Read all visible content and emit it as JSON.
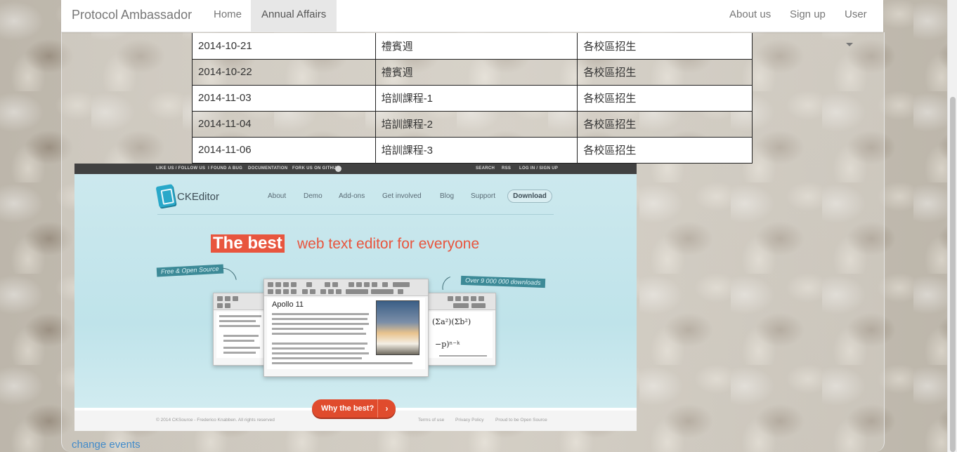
{
  "navbar": {
    "brand": "Protocol Ambassador",
    "items": [
      {
        "label": "Home",
        "active": false
      },
      {
        "label": "Annual Affairs",
        "active": true
      }
    ],
    "right_items": [
      {
        "label": "About us"
      },
      {
        "label": "Sign up"
      },
      {
        "label": "User"
      }
    ]
  },
  "events": [
    {
      "date": "2014-10-21",
      "name": "禮賓週",
      "note": "各校區招生"
    },
    {
      "date": "2014-10-22",
      "name": "禮賓週",
      "note": "各校區招生"
    },
    {
      "date": "2014-11-03",
      "name": "培訓課程-1",
      "note": "各校區招生"
    },
    {
      "date": "2014-11-04",
      "name": "培訓課程-2",
      "note": "各校區招生"
    },
    {
      "date": "2014-11-06",
      "name": "培訓課程-3",
      "note": "各校區招生"
    }
  ],
  "banner": {
    "topbar": {
      "left": [
        "LIKE US / FOLLOW US",
        "I FOUND A BUG",
        "DOCUMENTATION",
        "FORK US ON GITHUB"
      ],
      "right": [
        "SEARCH",
        "RSS",
        "LOG IN / SIGN UP"
      ]
    },
    "logo": "CKEditor",
    "nav": [
      "About",
      "Demo",
      "Add-ons",
      "Get involved",
      "Blog",
      "Support"
    ],
    "download": "Download",
    "headline_highlight": "The best",
    "headline_rest": "web text editor for everyone",
    "tag_left": "Free & Open Source",
    "tag_right": "Over 9 000 000 downloads",
    "editor_title": "Apollo 11",
    "cta": "Why the best?",
    "cta_arrow": "›",
    "footer_copy": "© 2014 CKSource - Frederico Knabben. All rights reserved",
    "footer_links": [
      "Terms of use",
      "Privacy Policy",
      "Proud to be Open Source"
    ]
  },
  "change_link": "change events",
  "colors": {
    "accent": "#e8553e",
    "link": "#428bca",
    "banner_bg": "#c6e6ec"
  }
}
